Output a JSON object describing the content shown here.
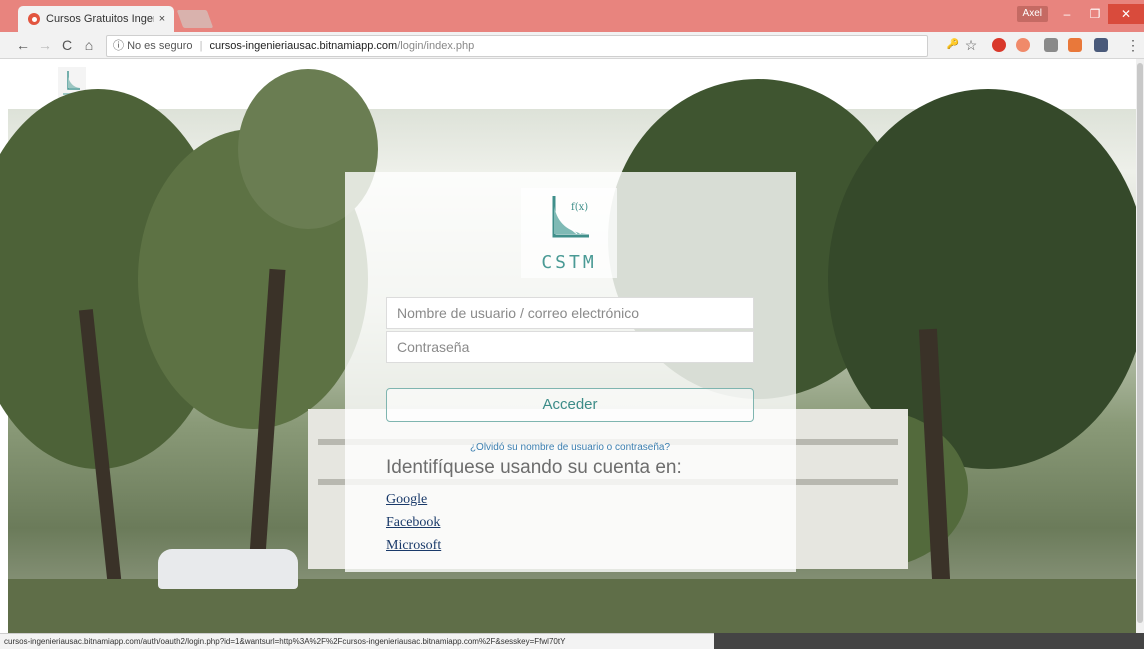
{
  "browser": {
    "tab_title": "Cursos Gratuitos Ingeni",
    "tab_close": "×",
    "user_badge": "Axel",
    "win_min": "–",
    "win_max": "❐",
    "win_close": "✕",
    "back": "←",
    "forward": "→",
    "reload": "C",
    "home": "⌂",
    "info_icon": "ⓘ",
    "security_text": "No es seguro",
    "separator": "|",
    "url_host": "cursos-ingenieriausac.bitnamiapp.com",
    "url_path": "/login/index.php",
    "key_icon": "🔑",
    "star_icon": "☆",
    "menu_icon": "⋮",
    "status_url": "cursos-ingenieriausac.bitnamiapp.com/auth/oauth2/login.php?id=1&wantsurl=http%3A%2F%2Fcursos-ingenieriausac.bitnamiapp.com%2F&sesskey=Ffwl70tY"
  },
  "site": {
    "logo_text": "CSTM"
  },
  "login": {
    "username_placeholder": "Nombre de usuario / correo electrónico",
    "password_placeholder": "Contraseña",
    "submit_label": "Acceder",
    "forgot_link": "¿Olvidó su nombre de usuario o contraseña?",
    "identify_heading": "Identifíquese usando su cuenta en:",
    "providers": [
      "Google",
      "Facebook",
      "Microsoft"
    ]
  },
  "colors": {
    "titlebar": "#e8847e",
    "accent": "#3c8c88",
    "close_button": "#d94b3c"
  }
}
